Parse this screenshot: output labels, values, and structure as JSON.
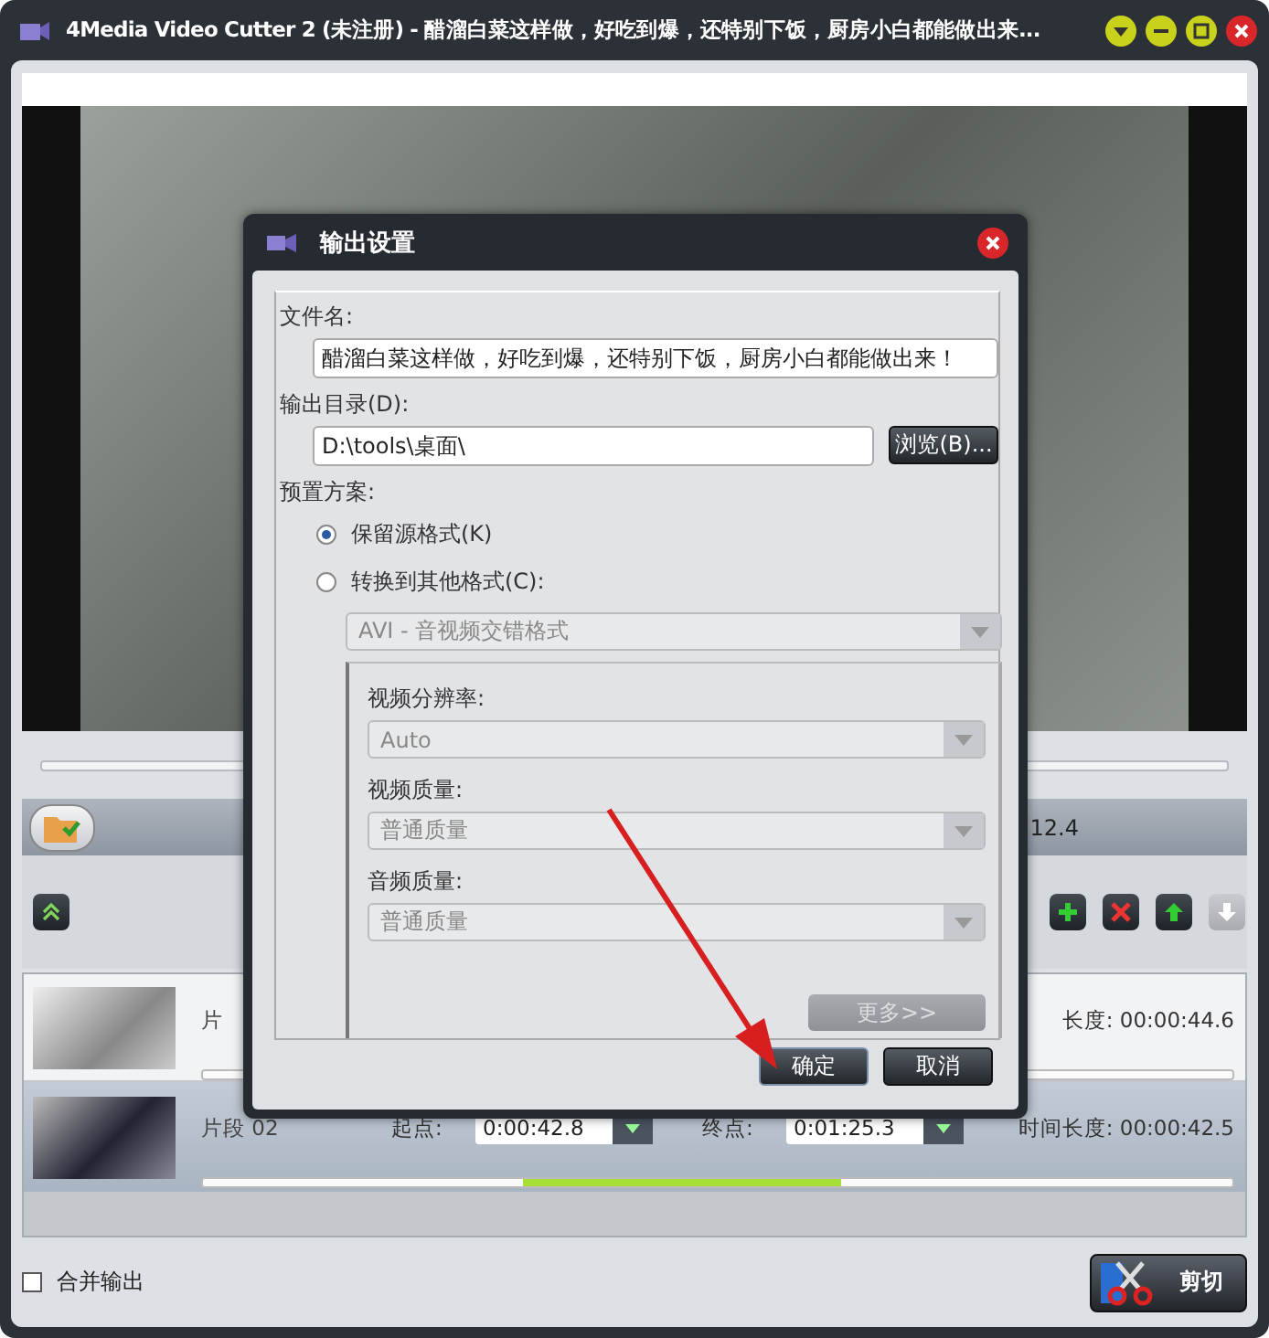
{
  "window": {
    "title": "4Media Video Cutter 2 (未注册) - 醋溜白菜这样做，好吃到爆，还特别下饭，厨房小白都能做出来..."
  },
  "toolbar": {
    "time_text": "12.4"
  },
  "list_tools": [
    {
      "kind": "add",
      "disabled": false
    },
    {
      "kind": "remove",
      "disabled": false
    },
    {
      "kind": "up",
      "disabled": false
    },
    {
      "kind": "down",
      "disabled": true
    }
  ],
  "clips": [
    {
      "label": "片",
      "duration": "长度: 00:00:44.6",
      "selected": false
    },
    {
      "label": "片段 02",
      "start_label": "起点:",
      "start": "0:00:42.8",
      "end_label": "终点:",
      "end": "0:01:25.3",
      "duration": "时间长度: 00:00:42.5",
      "selected": true
    }
  ],
  "merge_output": {
    "label": "合并输出",
    "checked": false
  },
  "cut_button": "剪切",
  "dialog": {
    "title": "输出设置",
    "filename_label": "文件名:",
    "filename": "醋溜白菜这样做，好吃到爆，还特别下饭，厨房小白都能做出来！",
    "dir_label": "输出目录(D):",
    "dir": "D:\\tools\\桌面\\",
    "browse": "浏览(B)...",
    "preset_label": "预置方案:",
    "options": [
      {
        "label": "保留源格式(K)",
        "selected": true
      },
      {
        "label": "转换到其他格式(C):",
        "selected": false
      }
    ],
    "format": {
      "value": "AVI - 音视频交错格式",
      "disabled": true
    },
    "settings": [
      {
        "label": "视频分辨率:",
        "value": "Auto",
        "disabled": true
      },
      {
        "label": "视频质量:",
        "value": "普通质量",
        "disabled": true
      },
      {
        "label": "音频质量:",
        "value": "普通质量",
        "disabled": true
      }
    ],
    "more": {
      "label": "更多>>",
      "disabled": true
    },
    "ok": "确定",
    "cancel": "取消"
  }
}
